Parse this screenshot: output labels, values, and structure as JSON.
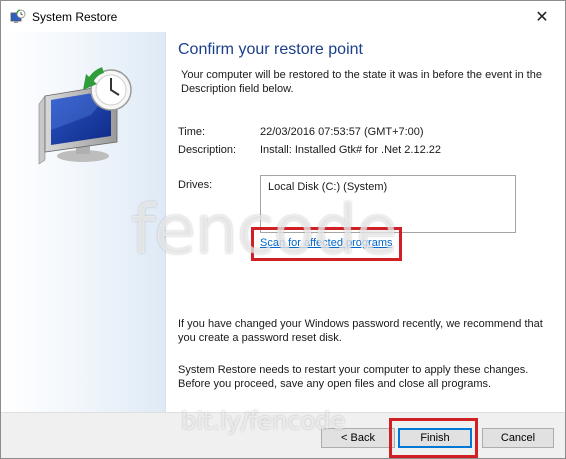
{
  "window": {
    "title": "System Restore",
    "close_icon": "close-icon"
  },
  "main": {
    "heading": "Confirm your restore point",
    "intro": "Your computer will be restored to the state it was in before the event in the Description field below.",
    "time_label": "Time:",
    "time_value": "22/03/2016 07:53:57 (GMT+7:00)",
    "description_label": "Description:",
    "description_value": "Install: Installed Gtk# for .Net 2.12.22",
    "drives_label": "Drives:",
    "drives": [
      "Local Disk (C:) (System)"
    ],
    "scan_link": "Scan for affected programs",
    "password_note": "If you have changed your Windows password recently, we recommend that you create a password reset disk.",
    "restart_note": "System Restore needs to restart your computer to apply these changes. Before you proceed, save any open files and close all programs."
  },
  "buttons": {
    "back": "< Back",
    "finish": "Finish",
    "cancel": "Cancel"
  },
  "watermark": {
    "main": "fencode",
    "url": "bit.ly/fencode"
  },
  "colors": {
    "heading": "#1b3f8b",
    "link": "#0066cc",
    "highlight": "#d11f26",
    "focus": "#0078d7"
  },
  "icons": [
    "system-restore-icon",
    "close-icon",
    "monitor-clock-icon"
  ]
}
